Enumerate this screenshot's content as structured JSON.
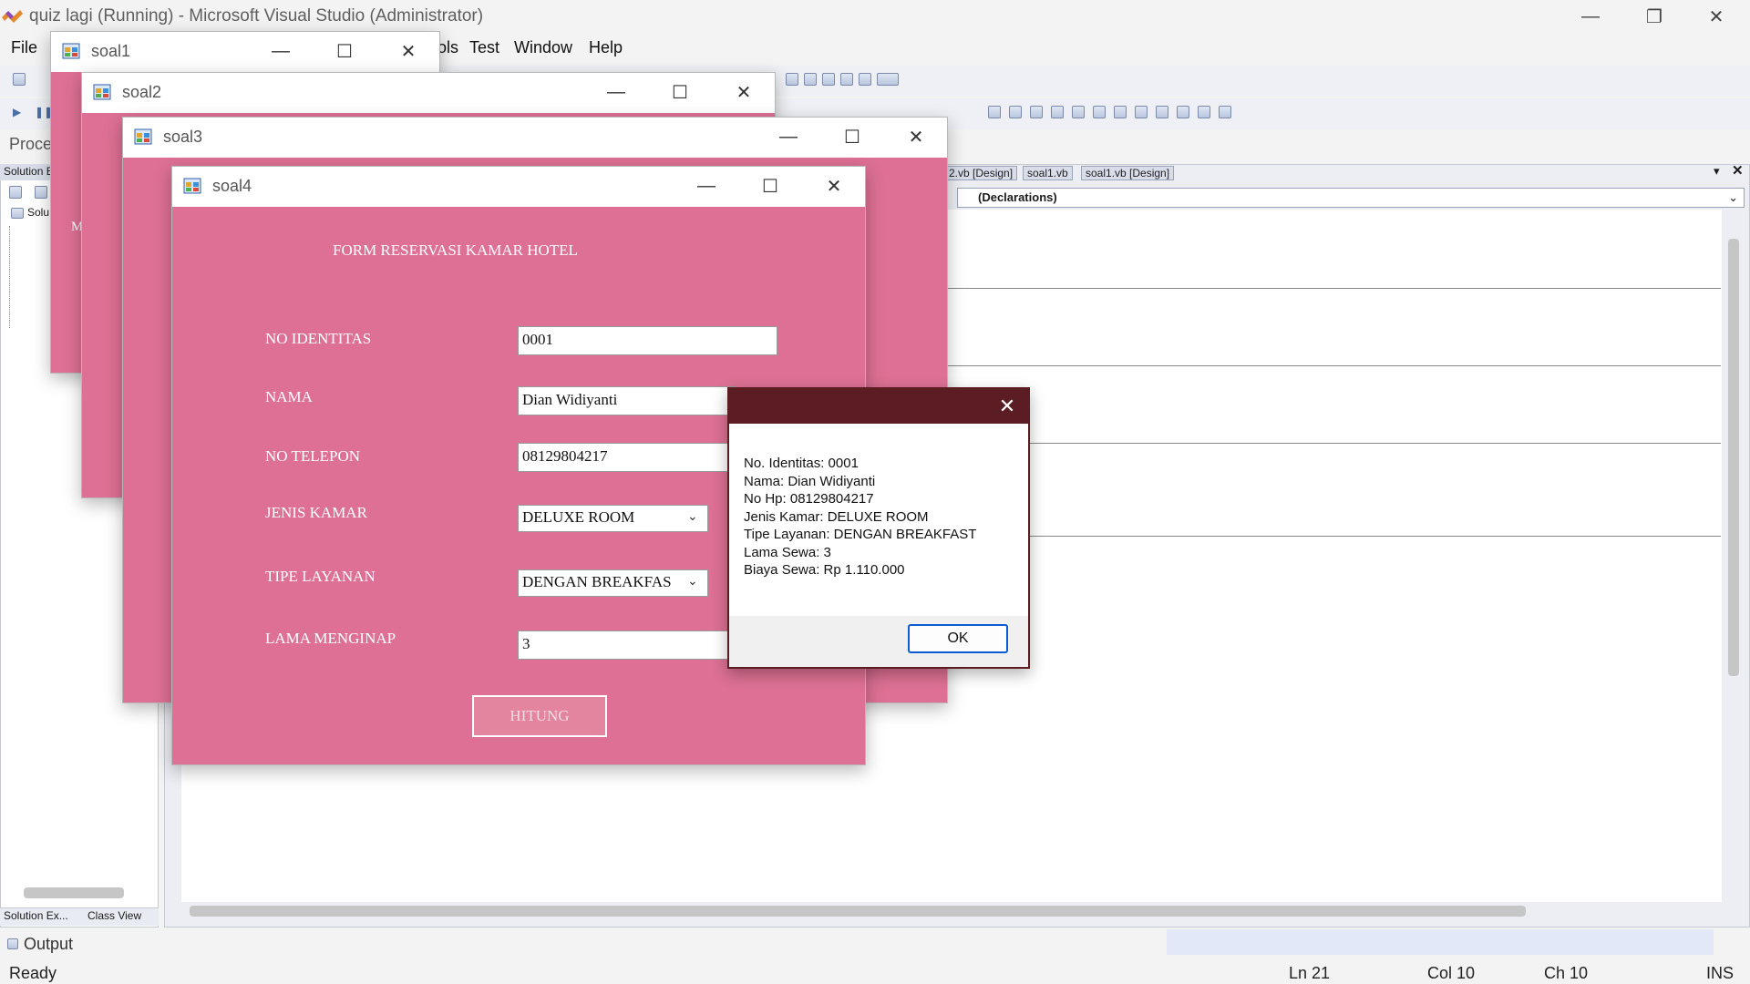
{
  "vs": {
    "title": "quiz lagi (Running) - Microsoft Visual Studio (Administrator)",
    "menu": [
      "File",
      "ols",
      "Test",
      "Window",
      "Help"
    ],
    "left_toolbar_label": "Proce",
    "solution_label": "Solution E",
    "tree_root": "Solu",
    "panel_tabs": [
      "Solution Ex...",
      "Class View"
    ],
    "doc_tabs": [
      "2.vb [Design]",
      "soal1.vb",
      "soal1.vb [Design]"
    ],
    "declarations": "(Declarations)",
    "output_label": "Output",
    "status": {
      "ready": "Ready",
      "ln": "Ln 21",
      "col": "Col 10",
      "ch": "Ch 10",
      "ins": "INS"
    }
  },
  "windows": {
    "soal1": {
      "title": "soal1",
      "snippet": "M"
    },
    "soal2": {
      "title": "soal2"
    },
    "soal3": {
      "title": "soal3"
    },
    "soal4": {
      "title": "soal4"
    }
  },
  "form": {
    "title": "FORM RESERVASI KAMAR HOTEL",
    "fields": {
      "no_identitas": {
        "label": "NO IDENTITAS",
        "value": "0001"
      },
      "nama": {
        "label": "NAMA",
        "value": "Dian Widiyanti"
      },
      "no_telepon": {
        "label": "NO TELEPON",
        "value": "08129804217"
      },
      "jenis_kamar": {
        "label": "JENIS KAMAR",
        "value": "DELUXE ROOM"
      },
      "tipe_layanan": {
        "label": "TIPE LAYANAN",
        "value": "DENGAN BREAKFAS"
      },
      "lama_menginap": {
        "label": "LAMA MENGINAP",
        "value": "3"
      }
    },
    "button": "HITUNG",
    "background_color": "#dd7094"
  },
  "message_box": {
    "lines": [
      "No. Identitas: 0001",
      "Nama: Dian Widiyanti",
      "No Hp: 08129804217",
      "Jenis Kamar: DELUXE ROOM",
      "Tipe Layanan: DENGAN BREAKFAST",
      "Lama Sewa: 3",
      "Biaya Sewa: Rp 1.110.000"
    ],
    "ok": "OK",
    "title_bar_color": "#5b1c24"
  }
}
